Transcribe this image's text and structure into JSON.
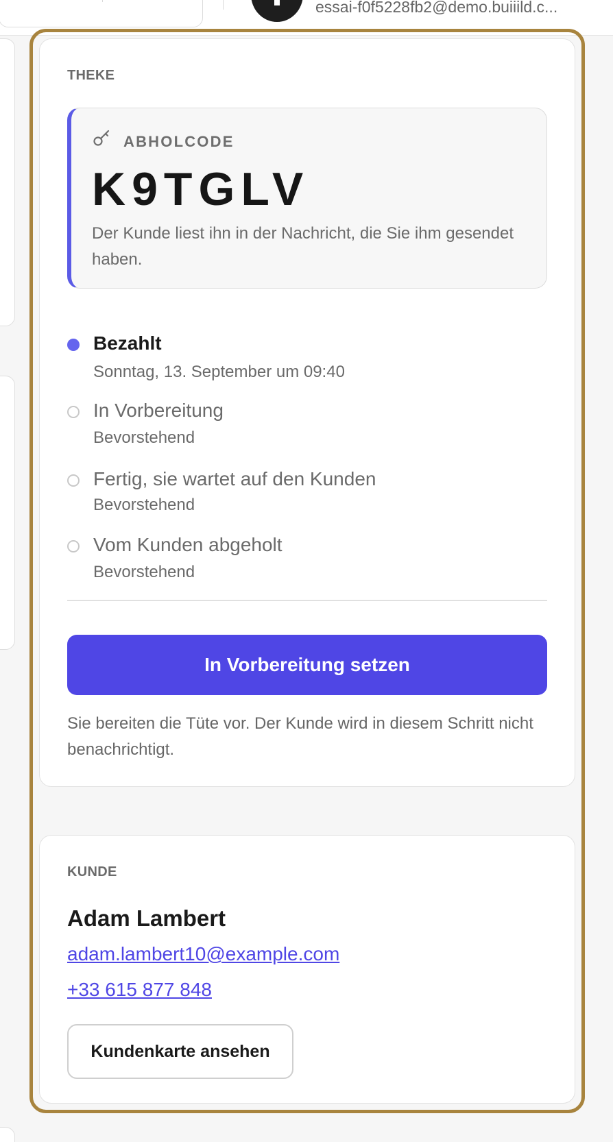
{
  "header": {
    "user_email": "essai-f0f5228fb2@demo.buiiild.c..."
  },
  "counter": {
    "section_label": "THEKE",
    "pickup": {
      "label": "ABHOLCODE",
      "code": "K9TGLV",
      "hint": "Der Kunde liest ihn in der Nachricht, die Sie ihm gesendet haben."
    },
    "steps": [
      {
        "title": "Bezahlt",
        "subtitle": "Sonntag, 13. September um 09:40",
        "state": "done"
      },
      {
        "title": "In Vorbereitung",
        "subtitle": "Bevorstehend",
        "state": "upcoming"
      },
      {
        "title": "Fertig, sie wartet auf den Kunden",
        "subtitle": "Bevorstehend",
        "state": "upcoming"
      },
      {
        "title": "Vom Kunden abgeholt",
        "subtitle": "Bevorstehend",
        "state": "upcoming"
      }
    ],
    "action_button": "In Vorbereitung setzen",
    "action_hint": "Sie bereiten die Tüte vor. Der Kunde wird in diesem Schritt nicht benachrichtigt."
  },
  "customer": {
    "section_label": "KUNDE",
    "name": "Adam Lambert",
    "email": "adam.lambert10@example.com",
    "phone": "+33 615 877 848",
    "view_card_button": "Kundenkarte ansehen"
  },
  "colors": {
    "accent": "#4f46e5",
    "highlight_frame": "#a8843e",
    "done_dot": "#6464ee"
  }
}
